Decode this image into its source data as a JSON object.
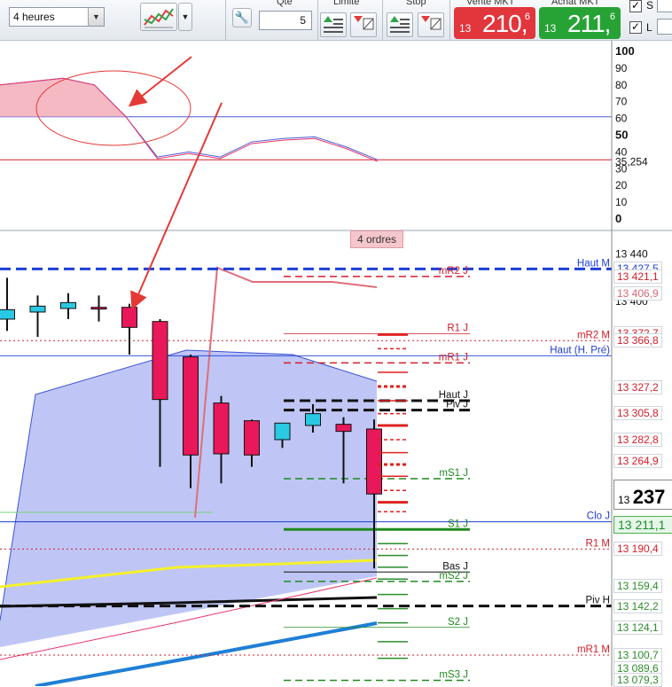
{
  "toolbar": {
    "timeframe": "4 heures",
    "qty_label": "Qté",
    "qty_value": "5",
    "limit_label": "Limite",
    "stop_label": "Stop",
    "sell": {
      "header": "Vente MKT",
      "small": "13",
      "big": "210,",
      "sup": "6",
      "color": "#e2363d"
    },
    "buy": {
      "header": "Achat MKT",
      "small": "13",
      "big": "211,",
      "sup": "6",
      "color": "#27a336"
    },
    "check_s_label": "S",
    "check_l_label": "L"
  },
  "indicator": {
    "axis_labels": [
      "100",
      "90",
      "80",
      "70",
      "60",
      "50",
      "40",
      "30",
      "20",
      "10",
      "0"
    ],
    "axis_values": [
      100,
      90,
      80,
      70,
      60,
      50,
      40,
      30,
      20,
      10,
      0
    ],
    "value_tag": "35,254",
    "line_color": "#4a5ad8",
    "signal_color": "#e8346a",
    "level_high": 61,
    "level_low": 35.3,
    "main_line": [
      80,
      82,
      84,
      80,
      61,
      37,
      40,
      37,
      46,
      48,
      49,
      43,
      35.3
    ],
    "signal_line": [
      80,
      82,
      84,
      80,
      61,
      37,
      40,
      37,
      46,
      48,
      49,
      43,
      35.3
    ]
  },
  "price": {
    "orders_badge": "4 ordres",
    "axis_labels": [
      {
        "value": 13440,
        "text": "13 440"
      },
      {
        "value": 13400,
        "text": "13 400"
      }
    ],
    "price_tags": [
      {
        "value": 13427.5,
        "text": "13 427,5",
        "color": "#1d3fd6"
      },
      {
        "value": 13421.1,
        "text": "13 421,1",
        "color": "#d21e2a"
      },
      {
        "value": 13406.9,
        "text": "13 406,9",
        "color": "#d86a77"
      },
      {
        "value": 13372.7,
        "text": "13 372,7",
        "color": "#d21e2a"
      },
      {
        "value": 13366.8,
        "text": "13 366,8",
        "color": "#d21e2a"
      },
      {
        "value": 13327.2,
        "text": "13 327,2",
        "color": "#d21e2a"
      },
      {
        "value": 13305.8,
        "text": "13 305,8",
        "color": "#d21e2a"
      },
      {
        "value": 13282.8,
        "text": "13 282,8",
        "color": "#d21e2a"
      },
      {
        "value": 13264.9,
        "text": "13 264,9",
        "color": "#d21e2a"
      },
      {
        "value": 13190.4,
        "text": "13 190,4",
        "color": "#d21e2a"
      },
      {
        "value": 13159.4,
        "text": "13 159,4",
        "color": "#2d8c2d"
      },
      {
        "value": 13142.2,
        "text": "13 142,2",
        "color": "#2d8c2d"
      },
      {
        "value": 13124.1,
        "text": "13 124,1",
        "color": "#2d8c2d"
      },
      {
        "value": 13100.7,
        "text": "13 100,7",
        "color": "#2d8c2d"
      },
      {
        "value": 13089.6,
        "text": "13 089,6",
        "color": "#2d8c2d"
      },
      {
        "value": 13079.3,
        "text": "13 079,3",
        "color": "#2d8c2d"
      }
    ],
    "last_price": {
      "small": "13",
      "big": "237"
    },
    "ask_price": "13 211,1",
    "level_lines": [
      {
        "value": 13427.5,
        "label": "Haut M",
        "color": "#1d3fd6",
        "style": "dash-thick",
        "from": 0
      },
      {
        "value": 13421.1,
        "label": "mR2 J",
        "color": "#d21e2a",
        "style": "dash",
        "from": 320
      },
      {
        "value": 13372.7,
        "label": "R1 J",
        "color": "#d21e2a",
        "style": "solid-thin",
        "from": 320
      },
      {
        "value": 13366.8,
        "label": "mR2 M",
        "color": "#d21e2a",
        "style": "dot",
        "from": 0
      },
      {
        "value": 13354,
        "label": "Haut (H. Pré)",
        "color": "#1d3fd6",
        "style": "solid-thin",
        "from": 0
      },
      {
        "value": 13348,
        "label": "mR1 J",
        "color": "#d21e2a",
        "style": "dash",
        "from": 320
      },
      {
        "value": 13316,
        "label": "Haut J",
        "color": "#111111",
        "style": "dash-thick",
        "from": 320
      },
      {
        "value": 13308,
        "label": "Piv J",
        "color": "#111111",
        "style": "dash-thick",
        "from": 320
      },
      {
        "value": 13250,
        "label": "mS1 J",
        "color": "#1f8a1f",
        "style": "dash",
        "from": 320
      },
      {
        "value": 13213.5,
        "label": "Clo J",
        "color": "#1d3fd6",
        "style": "solid",
        "from": 0
      },
      {
        "value": 13207,
        "label": "S1 J",
        "color": "#1f8a1f",
        "style": "solid-thick",
        "from": 320
      },
      {
        "value": 13190.4,
        "label": "R1 M",
        "color": "#d21e2a",
        "style": "dot",
        "from": 0
      },
      {
        "value": 13171,
        "label": "Bas J",
        "color": "#111111",
        "style": "solid",
        "from": 320
      },
      {
        "value": 13163,
        "label": "mS2 J",
        "color": "#1f8a1f",
        "style": "dash",
        "from": 320
      },
      {
        "value": 13142.2,
        "label": "Piv H",
        "color": "#111111",
        "style": "dash-thick",
        "from": 0
      },
      {
        "value": 13124.1,
        "label": "S2 J",
        "color": "#1f8a1f",
        "style": "solid-thin",
        "from": 320
      },
      {
        "value": 13100.7,
        "label": "mR1 M",
        "color": "#d21e2a",
        "style": "dot",
        "from": 0
      },
      {
        "value": 13079.3,
        "label": "mS3 J",
        "color": "#1f8a1f",
        "style": "dash",
        "from": 320
      }
    ],
    "candles": [
      {
        "open": 13385,
        "high": 13420,
        "low": 13375,
        "close": 13393,
        "bull": true
      },
      {
        "open": 13391,
        "high": 13405,
        "low": 13370,
        "close": 13396,
        "bull": true
      },
      {
        "open": 13394,
        "high": 13407,
        "low": 13385,
        "close": 13399,
        "bull": true
      },
      {
        "open": 13395,
        "high": 13405,
        "low": 13383,
        "close": 13394,
        "bull": false
      },
      {
        "open": 13395,
        "high": 13398,
        "low": 13355,
        "close": 13378,
        "bull": false
      },
      {
        "open": 13383,
        "high": 13385,
        "low": 13260,
        "close": 13317,
        "bull": false
      },
      {
        "open": 13353,
        "high": 13355,
        "low": 13242,
        "close": 13270,
        "bull": false
      },
      {
        "open": 13314,
        "high": 13320,
        "low": 13246,
        "close": 13271,
        "bull": false
      },
      {
        "open": 13299,
        "high": 13300,
        "low": 13260,
        "close": 13270,
        "bull": false
      },
      {
        "open": 13283,
        "high": 13295,
        "low": 13276,
        "close": 13297,
        "bull": true
      },
      {
        "open": 13295,
        "high": 13313,
        "low": 13289,
        "close": 13305,
        "bull": true
      },
      {
        "open": 13296,
        "high": 13302,
        "low": 13246,
        "close": 13290,
        "bull": false
      },
      {
        "open": 13292,
        "high": 13300,
        "low": 13174,
        "close": 13237,
        "bull": false
      }
    ],
    "bull_color": "#29c8e3",
    "bear_color": "#e8185a"
  }
}
